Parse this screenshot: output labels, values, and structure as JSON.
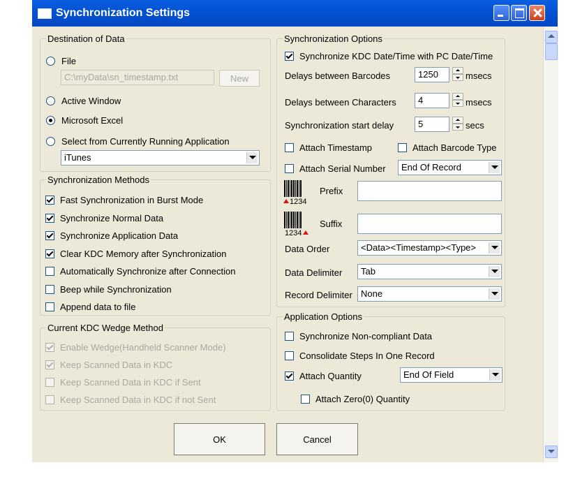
{
  "window": {
    "title": "Synchronization Settings"
  },
  "destination": {
    "legend": "Destination of Data",
    "file_label": "File",
    "file_path": "C:\\myData\\sn_timestamp.txt",
    "new_button": "New",
    "active_window_label": "Active Window",
    "excel_label": "Microsoft Excel",
    "running_app_label": "Select from Currently Running Application",
    "running_app_value": "iTunes",
    "selected": "Microsoft Excel"
  },
  "methods": {
    "legend": "Synchronization Methods",
    "items": [
      {
        "label": "Fast Synchronization in Burst Mode",
        "checked": true
      },
      {
        "label": "Synchronize Normal Data",
        "checked": true
      },
      {
        "label": "Synchronize Application Data",
        "checked": true
      },
      {
        "label": "Clear KDC Memory after Synchronization",
        "checked": true
      },
      {
        "label": "Automatically Synchronize after Connection",
        "checked": false
      },
      {
        "label": "Beep while Synchronization",
        "checked": false
      },
      {
        "label": "Append data to file",
        "checked": false
      }
    ]
  },
  "wedge": {
    "legend": "Current KDC Wedge Method",
    "items": [
      {
        "label": "Enable Wedge(Handheld Scanner Mode)",
        "checked": true
      },
      {
        "label": "Keep Scanned Data in KDC",
        "checked": true
      },
      {
        "label": "Keep Scanned Data in KDC if Sent",
        "checked": false
      },
      {
        "label": "Keep Scanned Data in KDC if not Sent",
        "checked": false
      }
    ]
  },
  "sync_options": {
    "legend": "Synchronization Options",
    "sync_datetime_label": "Synchronize KDC Date/Time with PC Date/Time",
    "delay_barcodes_label": "Delays between Barcodes",
    "delay_barcodes_value": "1250",
    "delay_chars_label": "Delays between Characters",
    "delay_chars_value": "4",
    "start_delay_label": "Synchronization start delay",
    "start_delay_value": "5",
    "unit_msecs": "msecs",
    "unit_secs": "secs",
    "attach_timestamp_label": "Attach Timestamp",
    "attach_barcode_type_label": "Attach Barcode Type",
    "attach_serial_label": "Attach Serial Number",
    "serial_position": "End Of Record",
    "prefix_label": "Prefix",
    "prefix_value": "",
    "suffix_label": "Suffix",
    "suffix_value": "",
    "barcode_digits": "1234",
    "data_order_label": "Data Order",
    "data_order_value": "<Data><Timestamp><Type>",
    "data_delimiter_label": "Data Delimiter",
    "data_delimiter_value": "Tab",
    "record_delimiter_label": "Record Delimiter",
    "record_delimiter_value": "None"
  },
  "app_options": {
    "legend": "Application Options",
    "noncompliant_label": "Synchronize Non-compliant Data",
    "consolidate_label": "Consolidate Steps In One Record",
    "attach_quantity_label": "Attach Quantity",
    "quantity_position": "End Of Field",
    "attach_zero_label": "Attach Zero(0) Quantity"
  },
  "buttons": {
    "ok": "OK",
    "cancel": "Cancel"
  }
}
